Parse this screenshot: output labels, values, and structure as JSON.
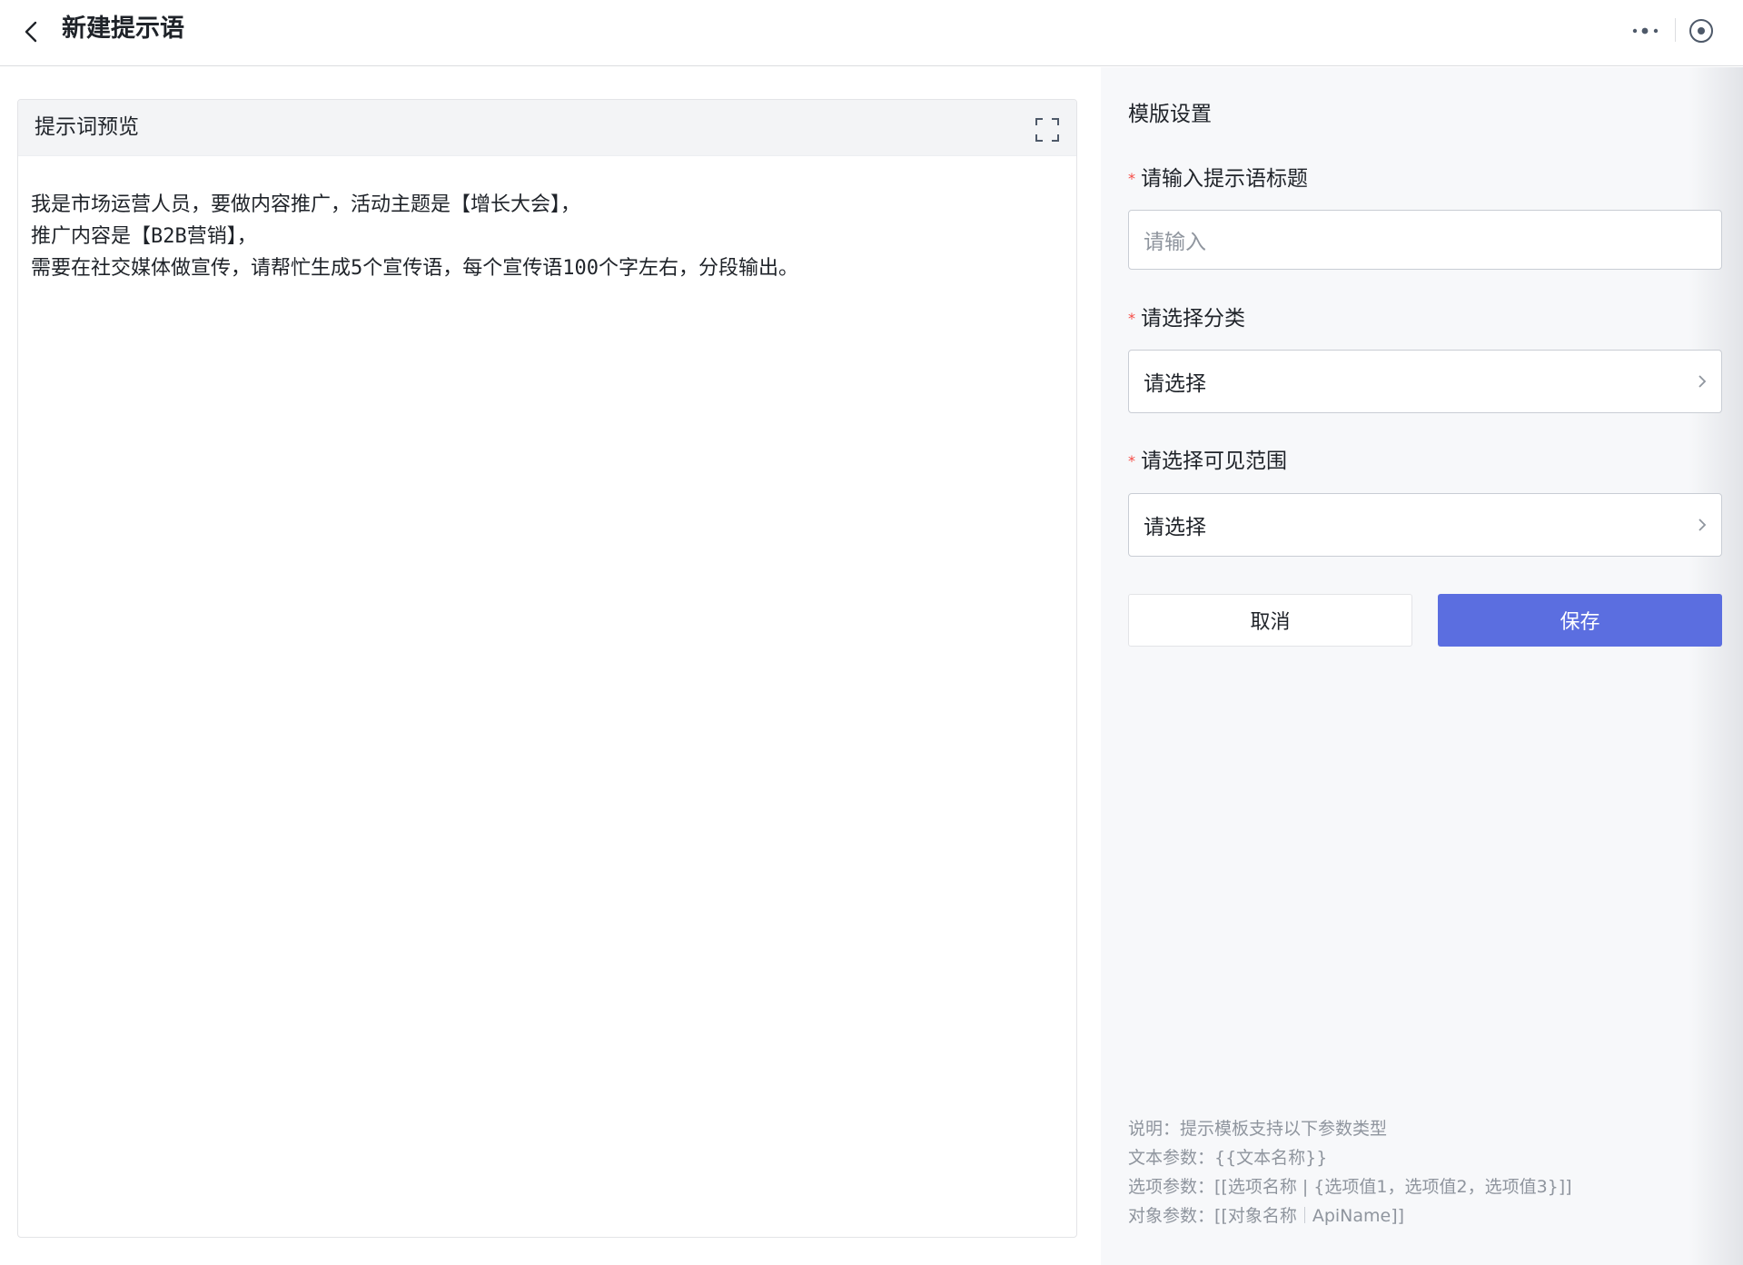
{
  "header": {
    "title": "新建提示语",
    "back_icon": "chevron-left-icon",
    "more_icon": "more-dots-icon",
    "target_icon": "target-circle-icon"
  },
  "preview": {
    "title": "提示词预览",
    "expand_icon": "fullscreen-icon",
    "lines": [
      "我是市场运营人员，要做内容推广，活动主题是【增长大会】，",
      "推广内容是【B2B营销】，",
      "需要在社交媒体做宣传，请帮忙生成5个宣传语，每个宣传语100个字左右，分段输出。"
    ]
  },
  "settings": {
    "section_title": "模版设置",
    "required_mark": "*",
    "title_field": {
      "label": "请输入提示语标题",
      "placeholder": "请输入"
    },
    "category_field": {
      "label": "请选择分类",
      "value": "请选择"
    },
    "scope_field": {
      "label": "请选择可见范围",
      "value": "请选择"
    },
    "cancel_label": "取消",
    "save_label": "保存"
  },
  "notes": {
    "line1": "说明：提示模板支持以下参数类型",
    "line2": "文本参数：{{文本名称}}",
    "line3": "选项参数：[[选项名称 | {选项值1，选项值2，选项值3}]]",
    "line4_prefix": "对象参数：[[对象名称",
    "line4_suffix": "ApiName]]"
  },
  "colors": {
    "primary": "#5b6ee0",
    "required": "#f54a45",
    "muted_text": "#8f959e"
  }
}
